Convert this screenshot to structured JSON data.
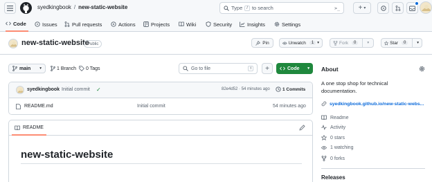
{
  "header": {
    "owner": "syedkingbook",
    "separator": "/",
    "repo": "new-static-website",
    "search_prefix": "Type",
    "search_key": "/",
    "search_suffix": "to search",
    "terminal_symbol": ">_",
    "plus_symbol": "+",
    "caret_symbol": "▾"
  },
  "tabs": [
    {
      "label": "Code",
      "icon": "code-icon",
      "active": true
    },
    {
      "label": "Issues",
      "icon": "issue-icon"
    },
    {
      "label": "Pull requests",
      "icon": "pull-request-icon"
    },
    {
      "label": "Actions",
      "icon": "actions-icon"
    },
    {
      "label": "Projects",
      "icon": "projects-icon"
    },
    {
      "label": "Wiki",
      "icon": "book-icon"
    },
    {
      "label": "Security",
      "icon": "shield-icon"
    },
    {
      "label": "Insights",
      "icon": "graph-icon"
    },
    {
      "label": "Settings",
      "icon": "gear-icon"
    }
  ],
  "repo": {
    "name": "new-static-website",
    "visibility": "Public",
    "pin_label": "Pin",
    "unwatch_label": "Unwatch",
    "unwatch_count": "1",
    "fork_label": "Fork",
    "fork_count": "0",
    "star_label": "Star",
    "star_count": "0"
  },
  "toolbar": {
    "branch": "main",
    "branch_count": "1 Branch",
    "tag_count": "0 Tags",
    "goto_placeholder": "Go to file",
    "goto_key": "t",
    "add_symbol": "+",
    "code_label": "Code"
  },
  "commit": {
    "author": "syedkingbook",
    "message": "Initial commit",
    "check": "✓",
    "hash_time": "82e4d52 · 54 minutes ago",
    "commits_label": "1 Commits"
  },
  "files": [
    {
      "name": "README.md",
      "message": "Initial commit",
      "time": "54 minutes ago"
    }
  ],
  "readme": {
    "tab_label": "README",
    "heading": "new-static-website"
  },
  "about": {
    "title": "About",
    "description_line1": "A one stop shop for technical",
    "description_line2": "documentation.",
    "link": "syedkingbook.github.io/new-static-webs...",
    "items": [
      {
        "label": "Readme",
        "icon": "book-icon"
      },
      {
        "label": "Activity",
        "icon": "pulse-icon"
      },
      {
        "label": "0 stars",
        "icon": "star-icon"
      },
      {
        "label": "1 watching",
        "icon": "eye-icon"
      },
      {
        "label": "0 forks",
        "icon": "fork-icon"
      }
    ],
    "releases_title": "Releases"
  },
  "colors": {
    "accent_green": "#1f883d",
    "link_blue": "#0969da",
    "active_tab_underline": "#fd8c73",
    "notification_dot": "#0969da"
  }
}
